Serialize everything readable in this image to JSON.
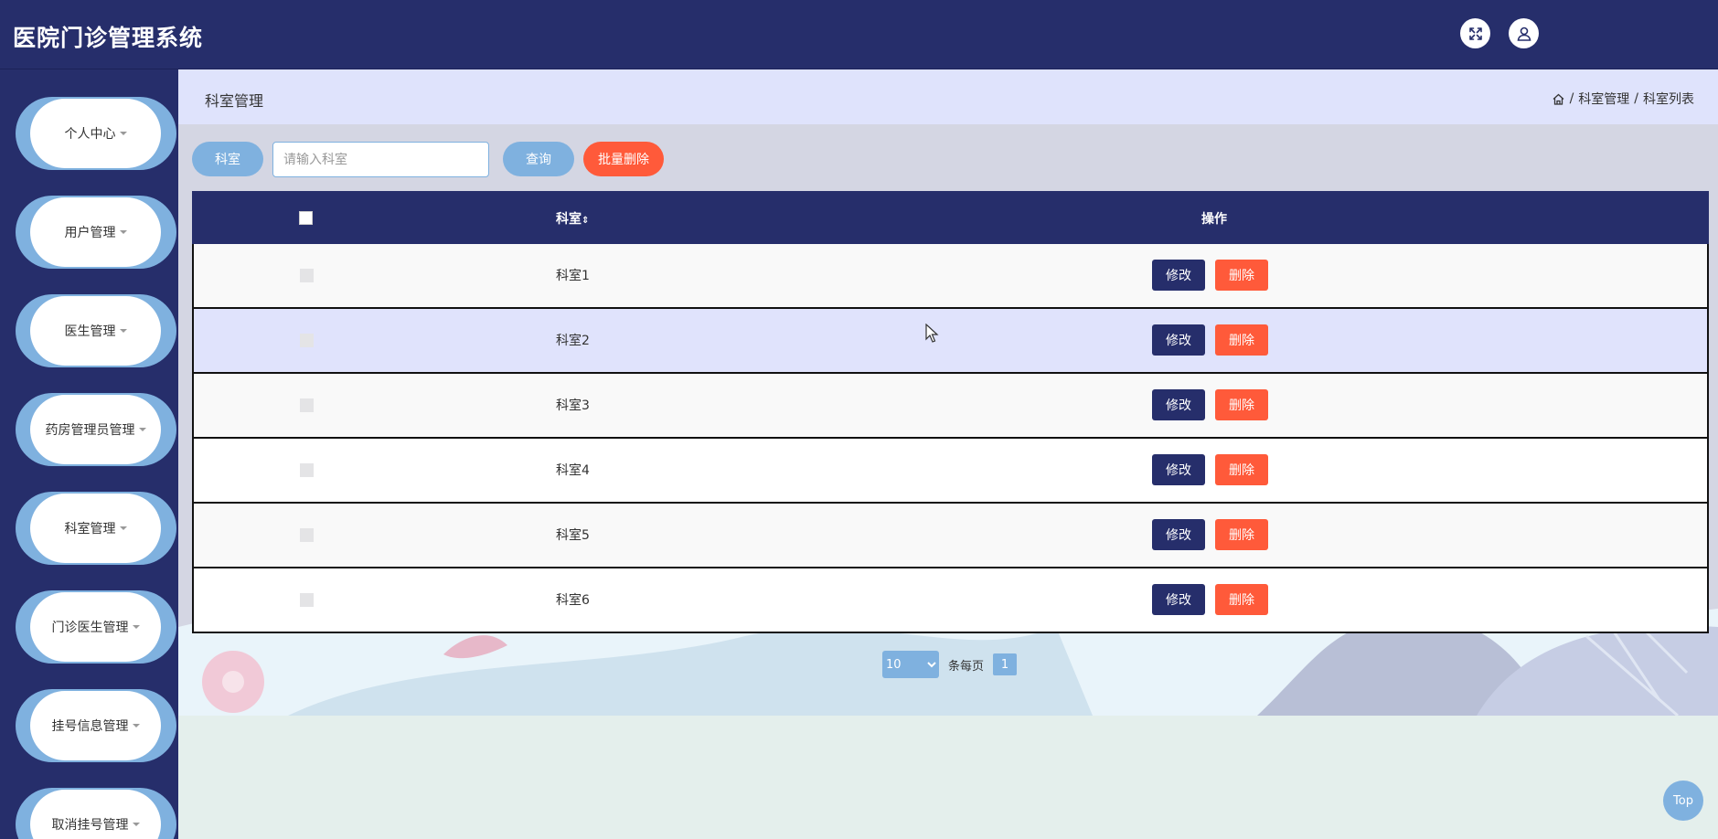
{
  "header": {
    "title": "医院门诊管理系统",
    "icons": [
      "fullscreen-icon",
      "user-icon"
    ]
  },
  "sidebar": {
    "items": [
      {
        "label": "个人中心"
      },
      {
        "label": "用户管理"
      },
      {
        "label": "医生管理"
      },
      {
        "label": "药房管理员管理"
      },
      {
        "label": "科室管理"
      },
      {
        "label": "门诊医生管理"
      },
      {
        "label": "挂号信息管理"
      },
      {
        "label": "取消挂号管理"
      }
    ]
  },
  "main": {
    "page_title": "科室管理",
    "breadcrumb": {
      "sep": "/",
      "items": [
        "科室管理",
        "科室列表"
      ]
    },
    "search": {
      "label": "科室",
      "placeholder": "请输入科室",
      "query_button": "查询",
      "batch_delete_button": "批量删除"
    },
    "table": {
      "headers": {
        "dept": "科室",
        "ops": "操作"
      },
      "rows": [
        {
          "dept": "科室1",
          "edit": "修改",
          "delete": "删除"
        },
        {
          "dept": "科室2",
          "edit": "修改",
          "delete": "删除"
        },
        {
          "dept": "科室3",
          "edit": "修改",
          "delete": "删除"
        },
        {
          "dept": "科室4",
          "edit": "修改",
          "delete": "删除"
        },
        {
          "dept": "科室5",
          "edit": "修改",
          "delete": "删除"
        },
        {
          "dept": "科室6",
          "edit": "修改",
          "delete": "删除"
        }
      ]
    },
    "pagination": {
      "page_size": "10",
      "page_size_suffix": "条每页",
      "current_page": "1"
    }
  },
  "top_button": "Top",
  "colors": {
    "navy": "#262e6b",
    "accent_blue": "#7fb1df",
    "danger": "#ff5a3a",
    "crumb_bg": "#dfe3fc"
  }
}
